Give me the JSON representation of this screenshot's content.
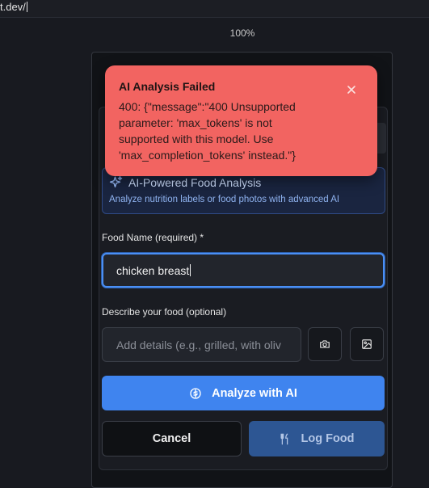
{
  "browser": {
    "url_fragment": "t.dev/",
    "zoom": "100%"
  },
  "toast": {
    "title": "AI Analysis Failed",
    "message": "400: {\"message\":\"400 Unsupported parameter: 'max_tokens' is not supported with this model. Use 'max_completion_tokens' instead.\"}",
    "color": "#f26461"
  },
  "ai_card": {
    "title": "AI-Powered Food Analysis",
    "subtitle": "Analyze nutrition labels or food photos with advanced AI",
    "icon": "sparkle-icon"
  },
  "form": {
    "food_name_label": "Food Name (required) *",
    "food_name_value": "chicken breast",
    "describe_label": "Describe your food (optional)",
    "describe_placeholder": "Add details (e.g., grilled, with oliv",
    "camera_icon": "camera-icon",
    "image_icon": "image-icon"
  },
  "actions": {
    "analyze_label": "Analyze with AI",
    "cancel_label": "Cancel",
    "log_label": "Log Food",
    "accent_color": "#3f84ef"
  }
}
